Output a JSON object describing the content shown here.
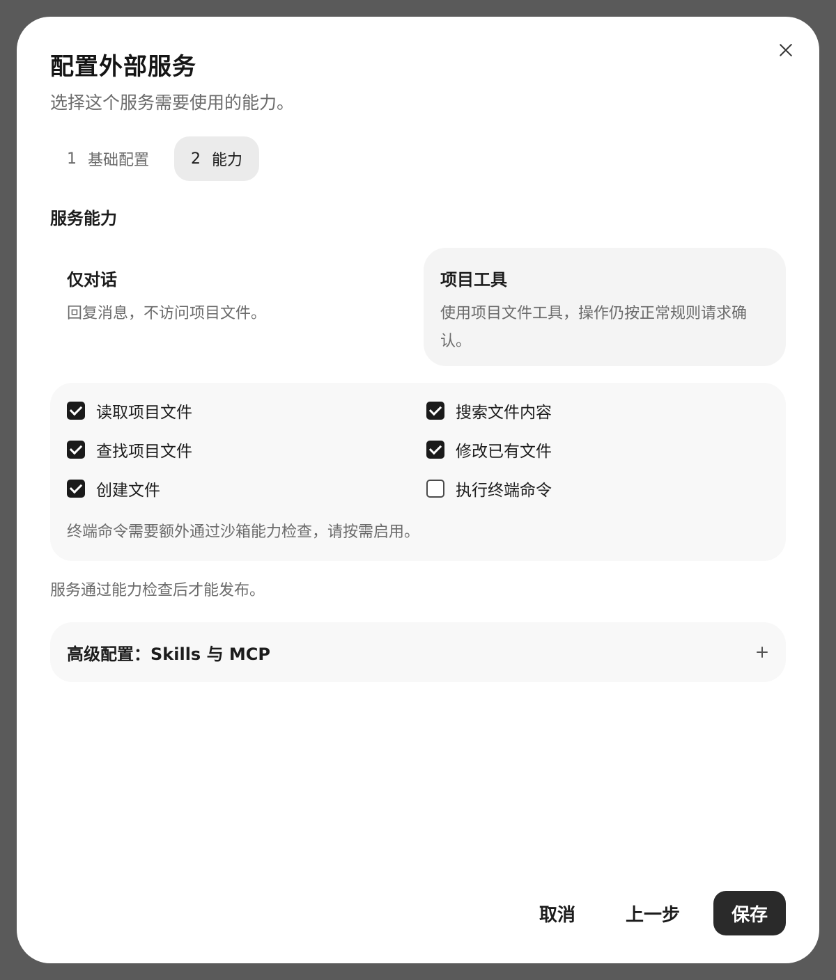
{
  "dialog": {
    "title": "配置外部服务",
    "subtitle": "选择这个服务需要使用的能力。"
  },
  "steps": [
    {
      "num": "1",
      "label": "基础配置",
      "active": false
    },
    {
      "num": "2",
      "label": "能力",
      "active": true
    }
  ],
  "capabilities": {
    "section_title": "服务能力",
    "modes": [
      {
        "title": "仅对话",
        "desc": "回复消息，不访问项目文件。",
        "selected": false
      },
      {
        "title": "项目工具",
        "desc": "使用项目文件工具，操作仍按正常规则请求确认。",
        "selected": true
      }
    ],
    "permissions": [
      {
        "label": "读取项目文件",
        "checked": true
      },
      {
        "label": "搜索文件内容",
        "checked": true
      },
      {
        "label": "查找项目文件",
        "checked": true
      },
      {
        "label": "修改已有文件",
        "checked": true
      },
      {
        "label": "创建文件",
        "checked": true
      },
      {
        "label": "执行终端命令",
        "checked": false
      }
    ],
    "permissions_note": "终端命令需要额外通过沙箱能力检查，请按需启用。",
    "publish_note": "服务通过能力检查后才能发布。"
  },
  "advanced": {
    "label": "高级配置：Skills 与 MCP",
    "icon": "plus-icon"
  },
  "actions": {
    "cancel": "取消",
    "back": "上一步",
    "save": "保存"
  },
  "colors": {
    "overlay": "#5a5a5a",
    "dialog_bg": "#ffffff",
    "primary_button": "#2a2a2a",
    "selected_card": "#f4f4f4",
    "panel_bg": "#f8f8f8",
    "active_step": "#ebebeb"
  }
}
